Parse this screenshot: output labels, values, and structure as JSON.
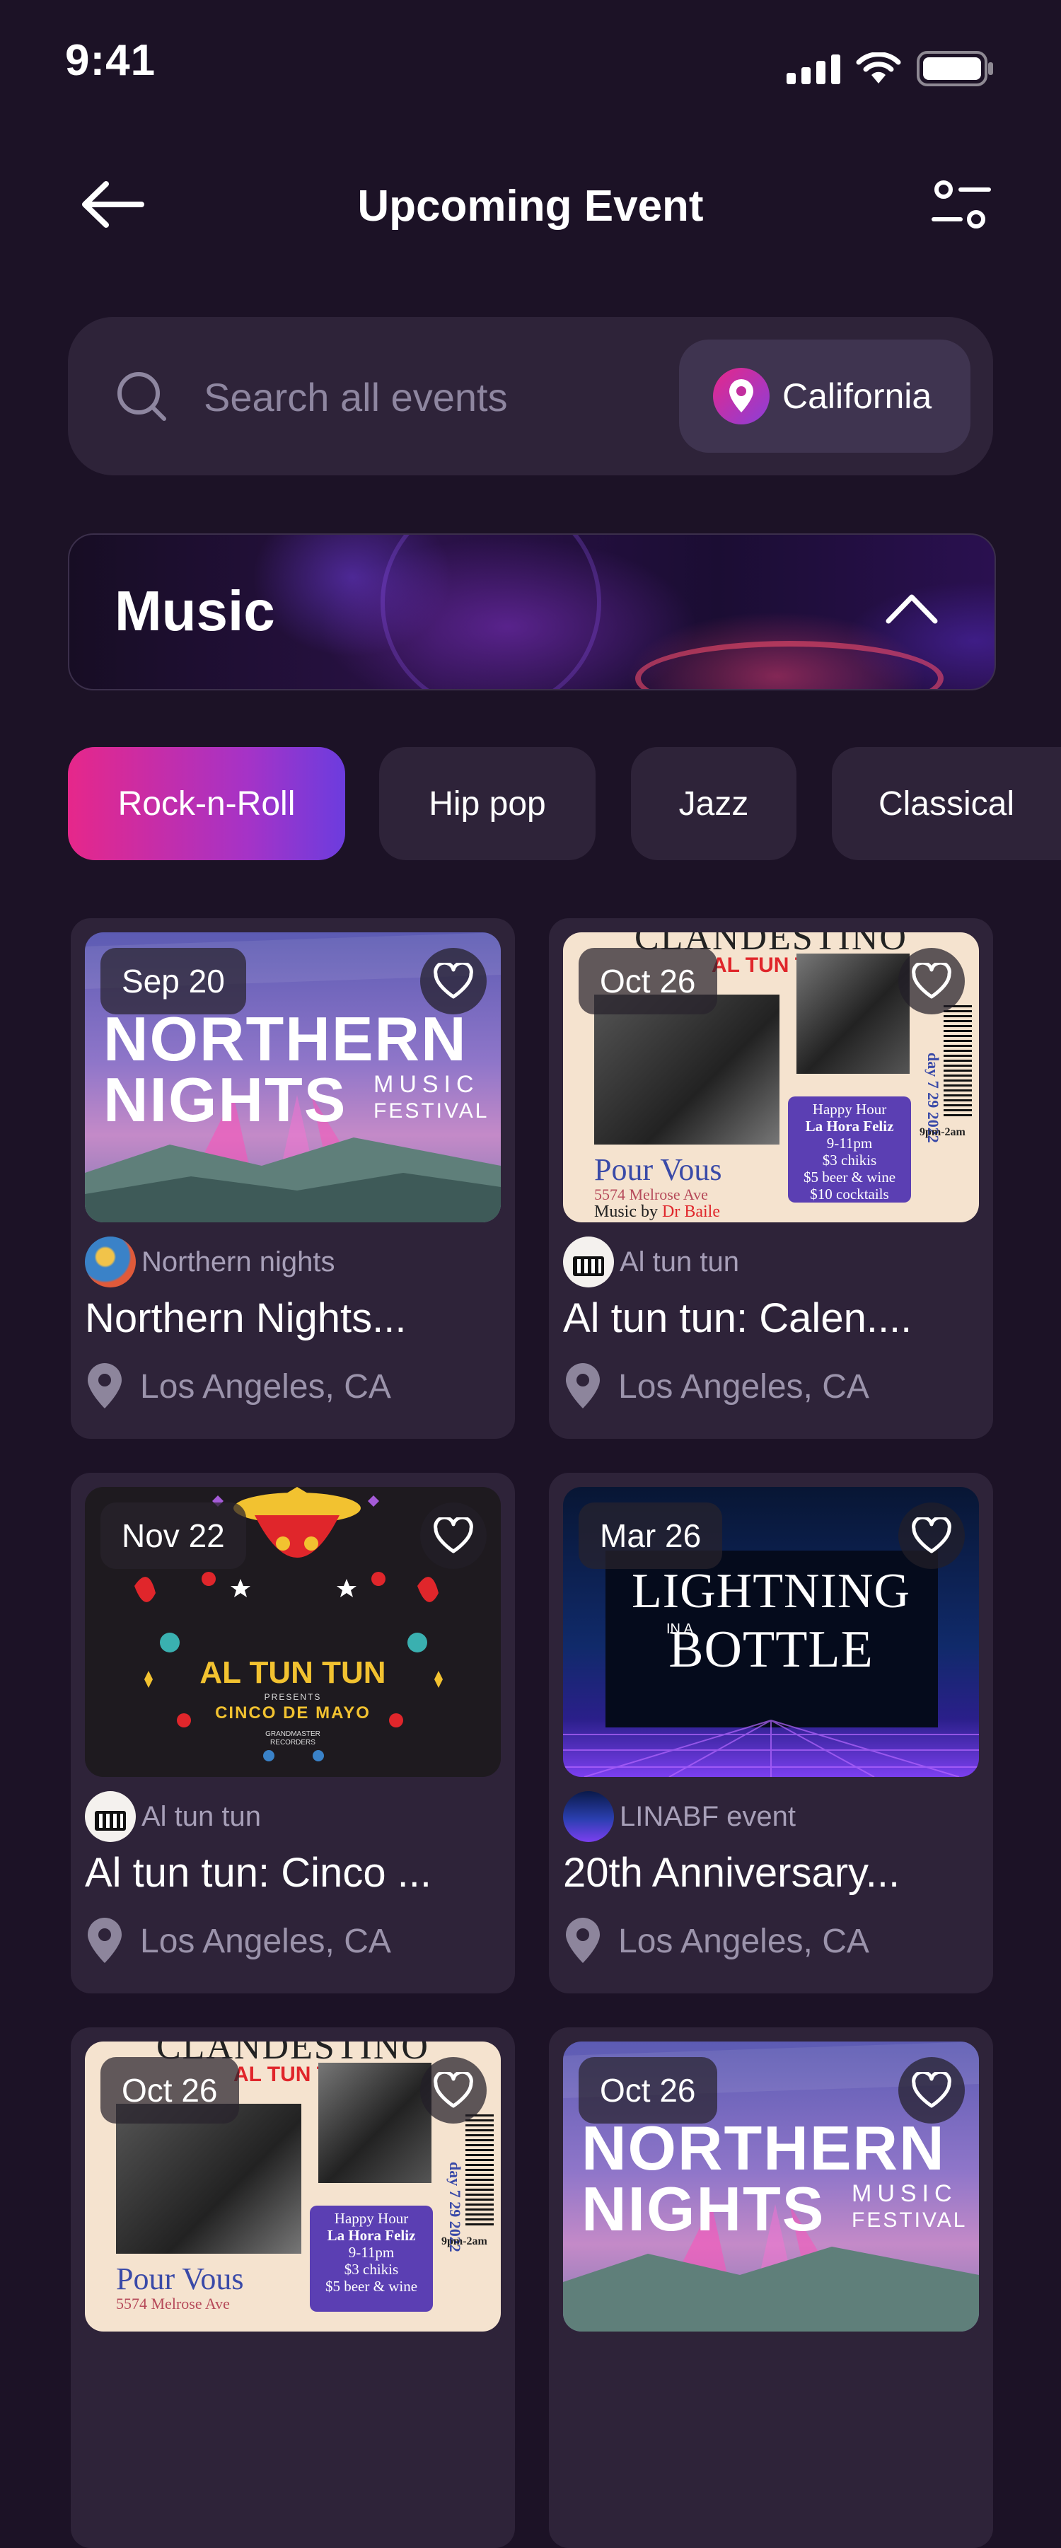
{
  "status_bar": {
    "time": "9:41"
  },
  "header": {
    "title": "Upcoming Event"
  },
  "search": {
    "placeholder": "Search all events",
    "location": "California"
  },
  "category": {
    "title": "Music"
  },
  "genres": [
    "Rock-n-Roll",
    "Hip pop",
    "Jazz",
    "Classical"
  ],
  "active_genre": "Rock-n-Roll",
  "events": [
    {
      "date": "Sep 20",
      "organizer": "Northern nights",
      "title": "Northern Nights...",
      "location": "Los Angeles, CA",
      "poster": "northern-nights-poster"
    },
    {
      "date": "Oct 26",
      "organizer": "Al tun tun",
      "title": "Al tun tun: Calen....",
      "location": "Los Angeles, CA",
      "poster": "clandestino-poster"
    },
    {
      "date": "Nov 22",
      "organizer": "Al tun tun",
      "title": "Al tun tun: Cinco ...",
      "location": "Los Angeles, CA",
      "poster": "cinco-de-mayo-poster"
    },
    {
      "date": "Mar 26",
      "organizer": "LINABF event",
      "title": "20th Anniversary...",
      "location": "Los Angeles, CA",
      "poster": "lightning-in-a-bottle-poster"
    },
    {
      "date": "Oct 26",
      "poster": "clandestino-poster"
    },
    {
      "date": "Oct 26",
      "poster": "northern-nights-poster"
    }
  ],
  "posters": {
    "northern": {
      "line1": "NORTHERN",
      "line2": "NIGHTS",
      "tag1": "MUSIC",
      "tag2": "FESTIVAL"
    },
    "clandestino": {
      "header": "CLANDESTINO",
      "brand": "AL TUN TUN",
      "venue": "Pour Vous",
      "address": "5574 Melrose Ave",
      "music_by": "Music by",
      "dj": "Dr Baile",
      "happy": "Happy Hour",
      "hora": "La Hora Feliz",
      "time": "9-11pm",
      "deal1": "$3 chikis",
      "deal2": "$5 beer & wine",
      "deal3": "$10 cocktails",
      "date_vert": "day 7 29 2022",
      "hours": "9pm-2am"
    },
    "cinco": {
      "brand": "AL TUN TUN",
      "presents": "PRESENTS",
      "event": "CINCO DE MAYO",
      "label": "GRANDMASTER RECORDERS"
    },
    "lightning": {
      "line1": "LIGHTNING",
      "line2": "IN A",
      "line3": "BOTTLE"
    }
  },
  "icons": {
    "back": "arrow-left-icon",
    "filter": "filter-icon",
    "search": "search-icon",
    "pin": "map-pin-icon",
    "chevron": "chevron-up-icon",
    "heart": "heart-icon"
  },
  "colors": {
    "background": "#1c1226",
    "surface": "#2e2339",
    "accent_start": "#e6278a",
    "accent_end": "#6c3cde",
    "muted_text": "#9b93ab"
  }
}
